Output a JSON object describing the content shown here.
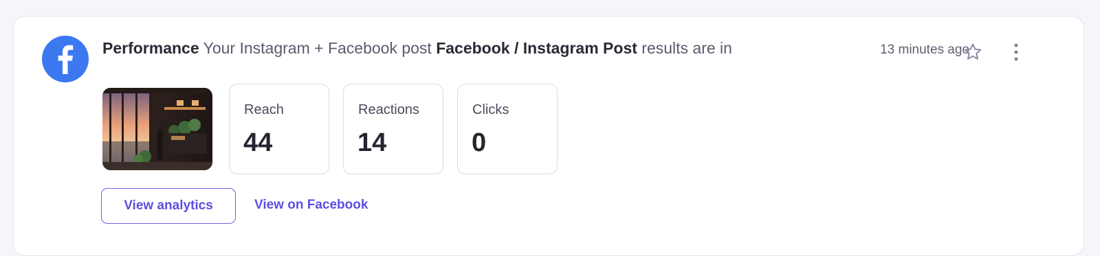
{
  "notification": {
    "source_icon": "facebook-icon",
    "brand_color": "#3c78f0",
    "category": "Performance",
    "text_before": " Your Instagram + Facebook post ",
    "post_name": "Facebook / Instagram Post",
    "text_after": " results are in",
    "timestamp": "13 minutes ago",
    "star_icon": "star-outline-icon",
    "menu_icon": "kebab-menu-icon"
  },
  "metrics": [
    {
      "label": "Reach",
      "value": "44"
    },
    {
      "label": "Reactions",
      "value": "14"
    },
    {
      "label": "Clicks",
      "value": "0"
    }
  ],
  "actions": {
    "view_analytics": "View analytics",
    "view_on_facebook": "View on Facebook",
    "accent_color": "#5a50e0"
  }
}
